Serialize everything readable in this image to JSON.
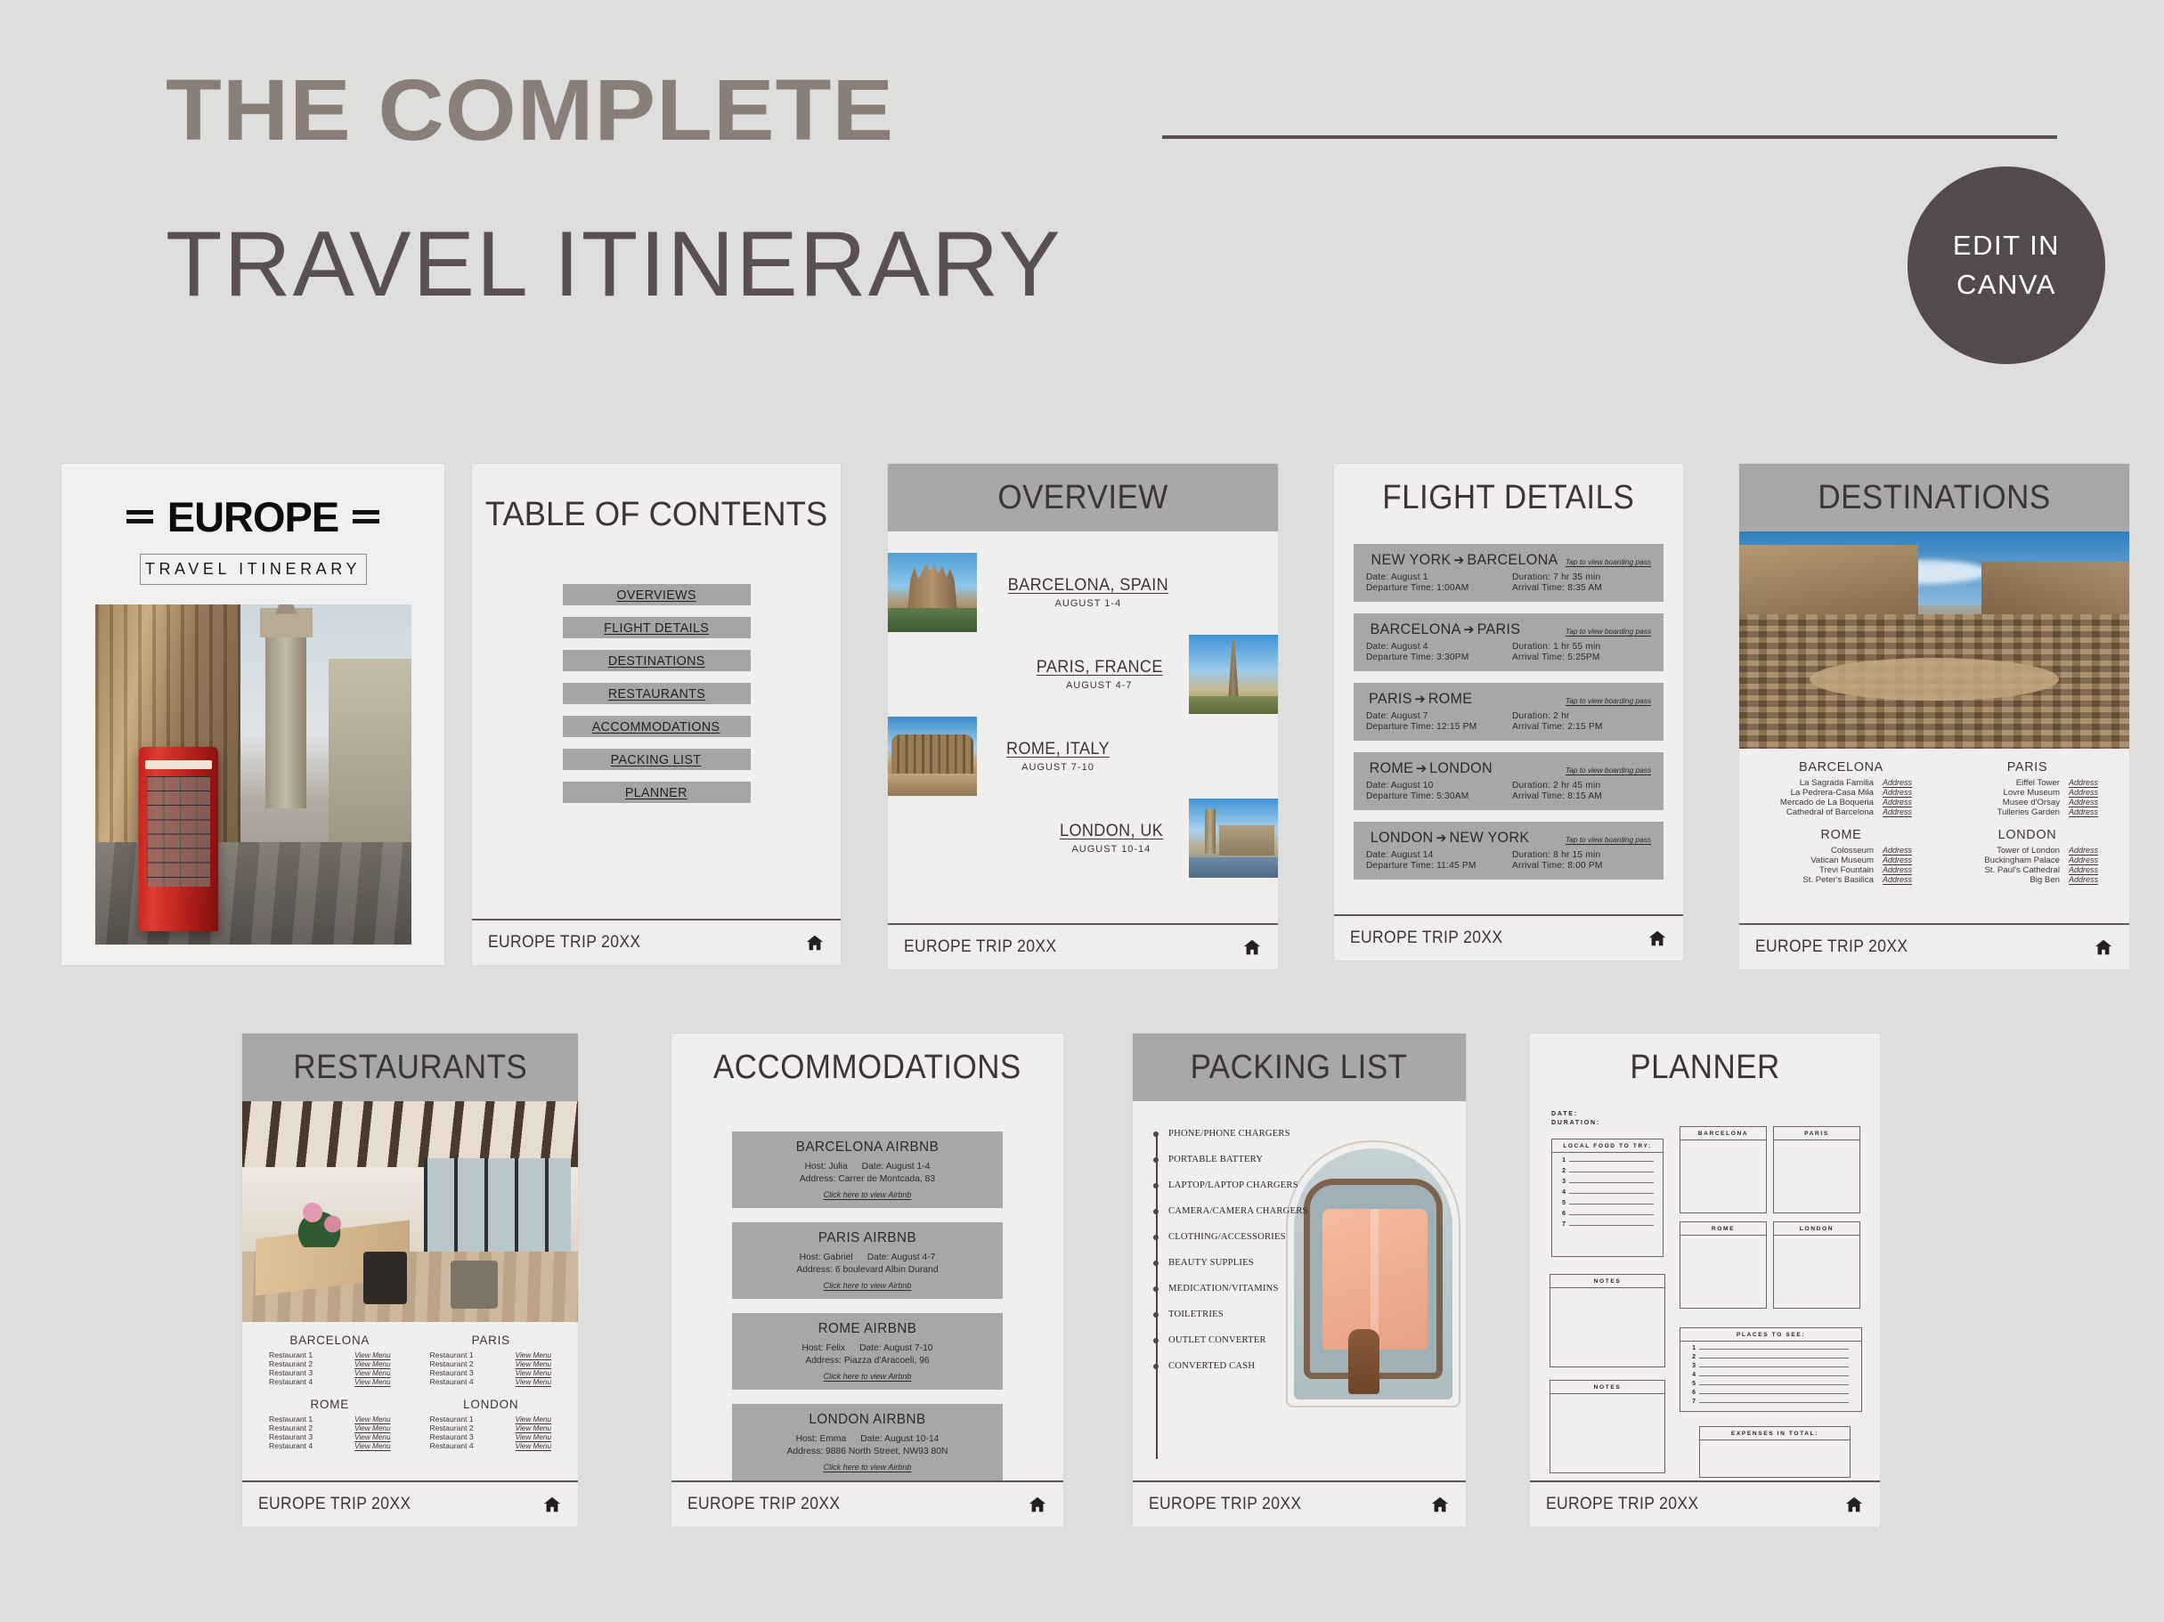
{
  "header": {
    "line1": "THE COMPLETE",
    "line2": "TRAVEL ITINERARY",
    "badge_line1": "EDIT  IN",
    "badge_line2": "CANVA",
    "accent_light": "#8a7f78",
    "accent_dark": "#5a4f52",
    "badge_bg": "#544a4e",
    "page_bg": "#dededd"
  },
  "footer": {
    "label": "EUROPE TRIP 20XX",
    "home_icon": "home-icon"
  },
  "cover": {
    "title": "EUROPE",
    "subtitle": "TRAVEL ITINERARY",
    "photo_alt": "london-red-telephone-box-big-ben-photo"
  },
  "toc": {
    "title": "TABLE OF CONTENTS",
    "items": [
      {
        "label": "OVERVIEWS"
      },
      {
        "label": "FLIGHT DETAILS"
      },
      {
        "label": "DESTINATIONS"
      },
      {
        "label": "RESTAURANTS"
      },
      {
        "label": "ACCOMMODATIONS"
      },
      {
        "label": "PACKING LIST"
      },
      {
        "label": "PLANNER"
      }
    ]
  },
  "overview": {
    "title": "OVERVIEW",
    "stops": [
      {
        "name": "BARCELONA, SPAIN",
        "dates": "AUGUST 1-4",
        "photo_alt": "sagrada-familia-photo"
      },
      {
        "name": "PARIS, FRANCE",
        "dates": "AUGUST 4-7",
        "photo_alt": "eiffel-tower-photo"
      },
      {
        "name": "ROME, ITALY",
        "dates": "AUGUST 7-10",
        "photo_alt": "colosseum-photo"
      },
      {
        "name": "LONDON, UK",
        "dates": "AUGUST 10-14",
        "photo_alt": "big-ben-photo"
      }
    ]
  },
  "flights": {
    "title": "FLIGHT DETAILS",
    "link_label": "Tap to view boarding pass",
    "items": [
      {
        "from": "NEW YORK",
        "to": "BARCELONA",
        "date": "Date: August 1",
        "duration": "Duration: 7 hr 35 min",
        "departure": "Departure Time: 1:00AM",
        "arrival": "Arrival Time: 8:35 AM"
      },
      {
        "from": "BARCELONA",
        "to": "PARIS",
        "date": "Date: August 4",
        "duration": "Duration: 1 hr 55 min",
        "departure": "Departure Time: 3:30PM",
        "arrival": "Arrival Time: 5:25PM"
      },
      {
        "from": "PARIS",
        "to": "ROME",
        "date": "Date: August 7",
        "duration": "Duration: 2 hr",
        "departure": "Departure Time: 12:15 PM",
        "arrival": "Arrival Time: 2:15 PM"
      },
      {
        "from": "ROME",
        "to": "LONDON",
        "date": "Date: August 10",
        "duration": "Duration: 2 hr 45 min",
        "departure": "Departure Time: 5:30AM",
        "arrival": "Arrival Time: 8:15 AM"
      },
      {
        "from": "LONDON",
        "to": "NEW YORK",
        "date": "Date: August 14",
        "duration": "Duration: 8 hr 15 min",
        "departure": "Departure Time: 11:45 PM",
        "arrival": "Arrival Time: 8:00 PM"
      }
    ]
  },
  "destinations": {
    "title": "DESTINATIONS",
    "photo_alt": "colosseum-interior-photo",
    "address_label": "Address",
    "cities": [
      {
        "name": "BARCELONA",
        "places": [
          "La Sagrada Familia",
          "La Pedrera-Casa Mila",
          "Mercado de La Boqueria",
          "Cathedral of Barcelona"
        ]
      },
      {
        "name": "PARIS",
        "places": [
          "Eiffel Tower",
          "Lovre Museum",
          "Musee d'Orsay",
          "Tulleries Garden"
        ]
      },
      {
        "name": "ROME",
        "places": [
          "Colosseum",
          "Vatican Museum",
          "Trevi Fountain",
          "St. Peter's Basilica"
        ]
      },
      {
        "name": "LONDON",
        "places": [
          "Tower of London",
          "Buckingham Palace",
          "St. Paul's Cathedral",
          "Big Ben"
        ]
      }
    ]
  },
  "restaurants": {
    "title": "RESTAURANTS",
    "photo_alt": "restaurant-dining-room-photo",
    "menu_label": "View Menu",
    "cities": [
      {
        "name": "BARCELONA",
        "rows": [
          "Restaurant 1",
          "Restaurant 2",
          "Restaurant 3",
          "Restaurant 4"
        ]
      },
      {
        "name": "PARIS",
        "rows": [
          "Restaurant 1",
          "Restaurant 2",
          "Restaurant 3",
          "Restaurant 4"
        ]
      },
      {
        "name": "ROME",
        "rows": [
          "Restaurant 1",
          "Restaurant 2",
          "Restaurant 3",
          "Restaurant 4"
        ]
      },
      {
        "name": "LONDON",
        "rows": [
          "Restaurant 1",
          "Restaurant 2",
          "Restaurant 3",
          "Restaurant 4"
        ]
      }
    ]
  },
  "accommodations": {
    "title": "ACCOMMODATIONS",
    "link_label": "Click here to view Airbnb",
    "items": [
      {
        "name": "BARCELONA AIRBNB",
        "host": "Host: Julia",
        "date": "Date: August 1-4",
        "address": "Address: Carrer de Montcada, 83"
      },
      {
        "name": "PARIS AIRBNB",
        "host": "Host: Gabriel",
        "date": "Date: August 4-7",
        "address": "Address: 6 boulevard Albin Durand"
      },
      {
        "name": "ROME AIRBNB",
        "host": "Host: Felix",
        "date": "Date: August 7-10",
        "address": "Address: Piazza d'Aracoeli, 96"
      },
      {
        "name": "LONDON AIRBNB",
        "host": "Host: Emma",
        "date": "Date: August 10-14",
        "address": "Address: 9886 North Street, NW93 80N"
      }
    ]
  },
  "packing": {
    "title": "PACKING LIST",
    "photo_alt": "suitcase-packing-shirt-photo",
    "items": [
      "PHONE/PHONE CHARGERS",
      "PORTABLE BATTERY",
      "LAPTOP/LAPTOP CHARGERS",
      "CAMERA/CAMERA CHARGERS",
      "CLOTHING/ACCESSORIES",
      "BEAUTY SUPPLIES",
      "MEDICATION/VITAMINS",
      "TOILETRIES",
      "OUTLET CONVERTER",
      "CONVERTED CASH"
    ]
  },
  "planner": {
    "title": "PLANNER",
    "date_label": "DATE:",
    "duration_label": "DURATION:",
    "food_label": "LOCAL FOOD TO TRY:",
    "notes_label": "NOTES",
    "places_label": "PLACES TO SEE:",
    "expenses_label": "EXPENSES IN TOTAL:",
    "city_boxes": [
      "BARCELONA",
      "PARIS",
      "ROME",
      "LONDON"
    ],
    "food_numbers": [
      "1",
      "2",
      "3",
      "4",
      "5",
      "6",
      "7"
    ],
    "places_numbers": [
      "1",
      "2",
      "3",
      "4",
      "5",
      "6",
      "7"
    ]
  }
}
